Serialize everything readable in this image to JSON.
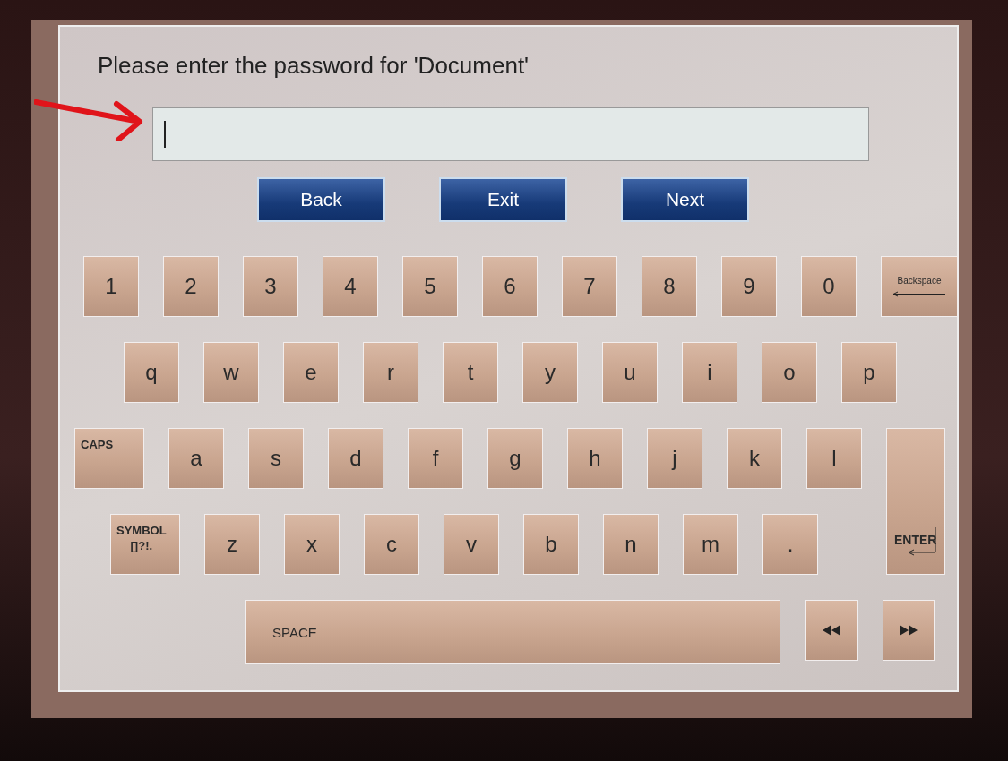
{
  "title": "Please enter the password for 'Document'",
  "nav_buttons": [
    "Back",
    "Exit",
    "Next"
  ],
  "keyboard": {
    "rows": [
      {
        "keys": [
          {
            "kind": "char",
            "label": "1"
          },
          {
            "kind": "char",
            "label": "2"
          },
          {
            "kind": "char",
            "label": "3"
          },
          {
            "kind": "char",
            "label": "4"
          },
          {
            "kind": "char",
            "label": "5"
          },
          {
            "kind": "char",
            "label": "6"
          },
          {
            "kind": "char",
            "label": "7"
          },
          {
            "kind": "char",
            "label": "8"
          },
          {
            "kind": "char",
            "label": "9"
          },
          {
            "kind": "char",
            "label": "0"
          },
          {
            "kind": "backspace",
            "label": "Backspace"
          }
        ]
      },
      {
        "keys": [
          {
            "kind": "char",
            "label": "q"
          },
          {
            "kind": "char",
            "label": "w"
          },
          {
            "kind": "char",
            "label": "e"
          },
          {
            "kind": "char",
            "label": "r"
          },
          {
            "kind": "char",
            "label": "t"
          },
          {
            "kind": "char",
            "label": "y"
          },
          {
            "kind": "char",
            "label": "u"
          },
          {
            "kind": "char",
            "label": "i"
          },
          {
            "kind": "char",
            "label": "o"
          },
          {
            "kind": "char",
            "label": "p"
          }
        ]
      },
      {
        "keys": [
          {
            "kind": "label",
            "label": "CAPS"
          },
          {
            "kind": "char",
            "label": "a"
          },
          {
            "kind": "char",
            "label": "s"
          },
          {
            "kind": "char",
            "label": "d"
          },
          {
            "kind": "char",
            "label": "f"
          },
          {
            "kind": "char",
            "label": "g"
          },
          {
            "kind": "char",
            "label": "h"
          },
          {
            "kind": "char",
            "label": "j"
          },
          {
            "kind": "char",
            "label": "k"
          },
          {
            "kind": "char",
            "label": "l"
          },
          {
            "kind": "enter",
            "label": "ENTER"
          }
        ]
      },
      {
        "keys": [
          {
            "kind": "label",
            "label": "SYMBOL\n[]?!."
          },
          {
            "kind": "char",
            "label": "z"
          },
          {
            "kind": "char",
            "label": "x"
          },
          {
            "kind": "char",
            "label": "c"
          },
          {
            "kind": "char",
            "label": "v"
          },
          {
            "kind": "char",
            "label": "b"
          },
          {
            "kind": "char",
            "label": "n"
          },
          {
            "kind": "char",
            "label": "m"
          },
          {
            "kind": "char",
            "label": "."
          }
        ]
      },
      {
        "keys": [
          {
            "kind": "space",
            "label": "SPACE"
          },
          {
            "kind": "left"
          },
          {
            "kind": "right"
          }
        ]
      }
    ]
  }
}
